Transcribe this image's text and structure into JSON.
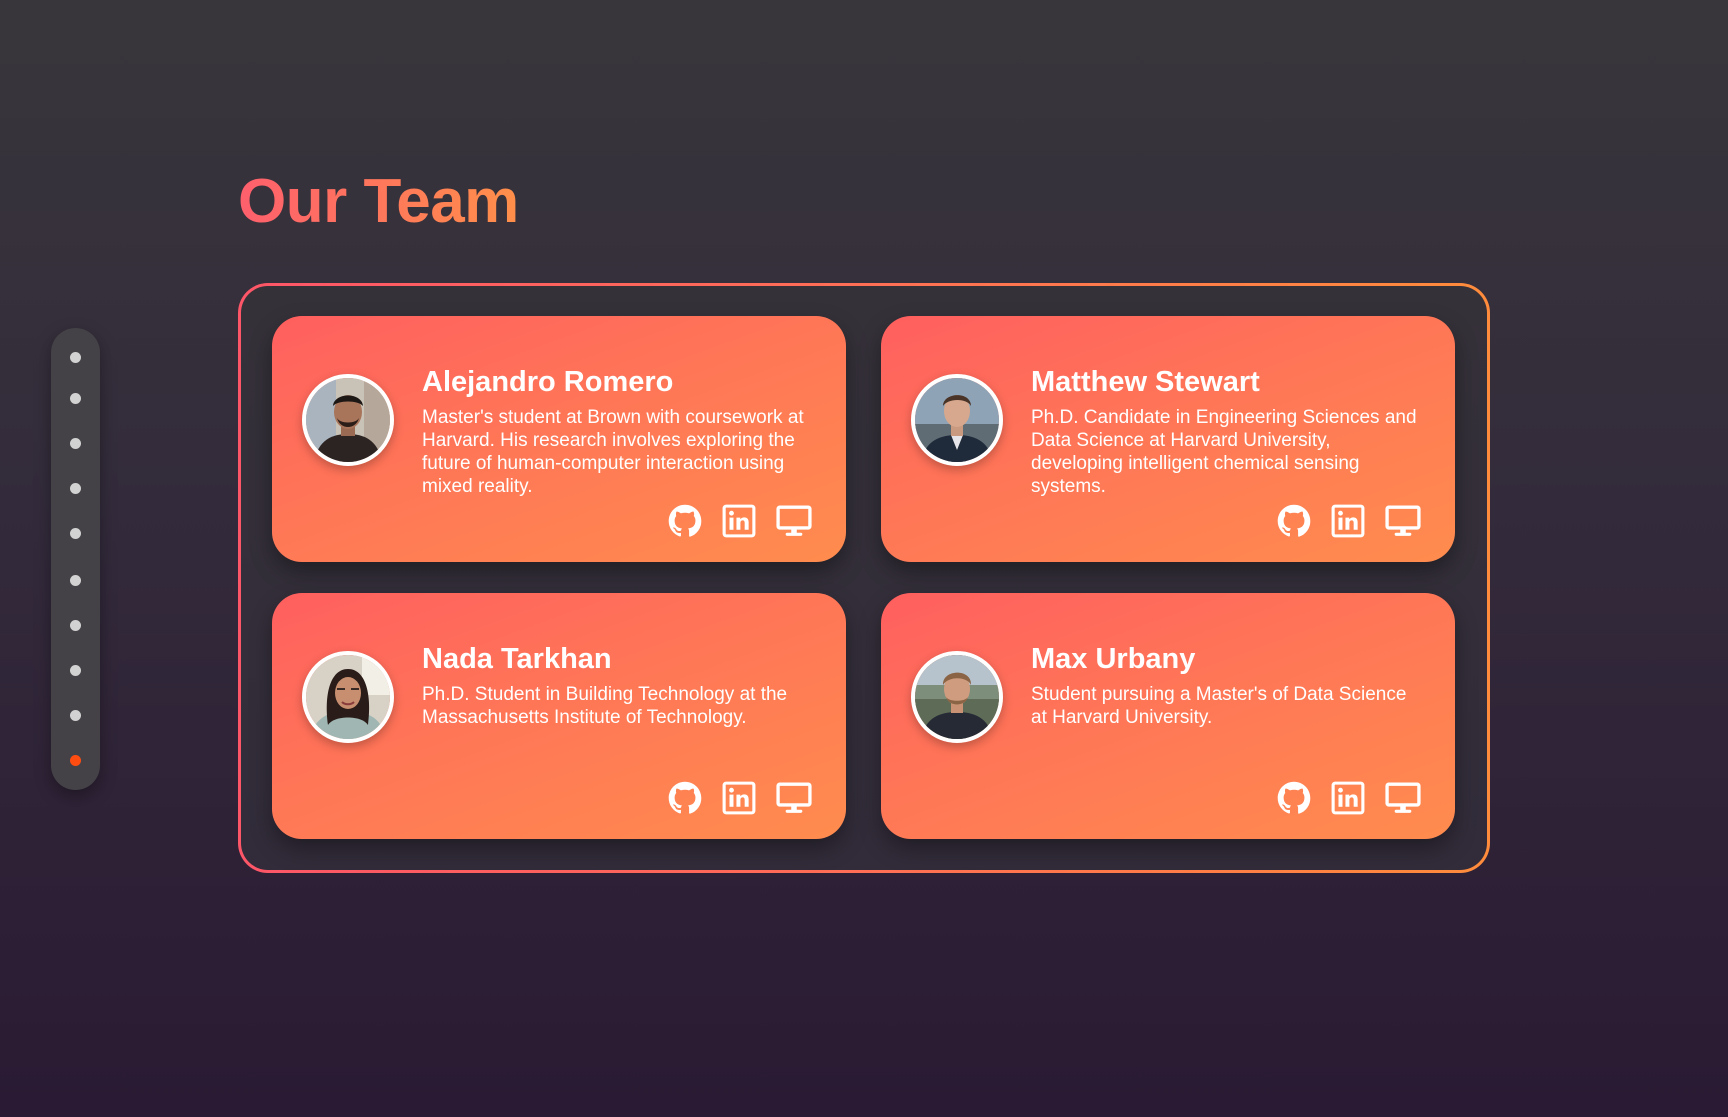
{
  "page": {
    "title": "Our Team"
  },
  "theme": {
    "accent_start": "#fe5f6d",
    "accent_end": "#ff8f4a",
    "active_dot": "#ff4d12",
    "inactive_dot": "#d2d2d2"
  },
  "dot_nav": {
    "count": 10,
    "active_index": 9
  },
  "team": [
    {
      "name": "Alejandro Romero",
      "bio": "Master's student at Brown with coursework at Harvard. His research involves exploring the future of human-computer interaction using mixed reality.",
      "links": [
        "github-icon",
        "linkedin-icon",
        "monitor-icon"
      ]
    },
    {
      "name": "Matthew Stewart",
      "bio": "Ph.D. Candidate in Engineering Sciences and Data Science at Harvard University, developing intelligent chemical sensing systems.",
      "links": [
        "github-icon",
        "linkedin-icon",
        "monitor-icon"
      ]
    },
    {
      "name": "Nada Tarkhan",
      "bio": "Ph.D. Student in Building Technology at the Massachusetts Institute of Technology.",
      "links": [
        "github-icon",
        "linkedin-icon",
        "monitor-icon"
      ]
    },
    {
      "name": "Max Urbany",
      "bio": "Student pursuing a Master's of Data Science at Harvard University.",
      "links": [
        "github-icon",
        "linkedin-icon",
        "monitor-icon"
      ]
    }
  ]
}
